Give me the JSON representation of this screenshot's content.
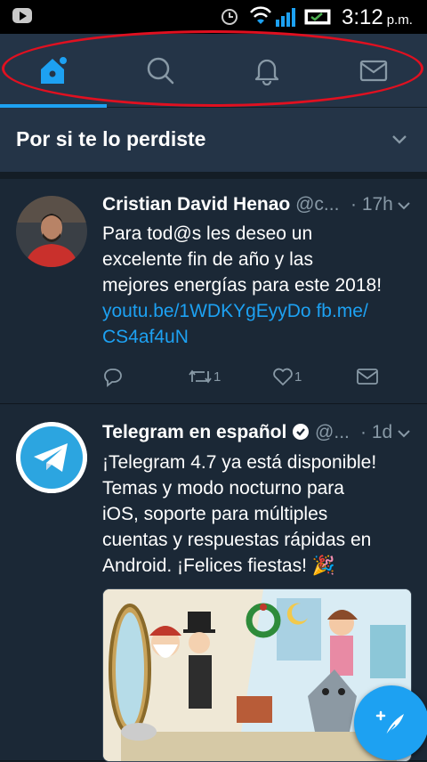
{
  "status_bar": {
    "time": "3:12",
    "ampm": "p.m."
  },
  "tabs": [
    {
      "name": "home",
      "icon": "home-icon",
      "active": true
    },
    {
      "name": "search",
      "icon": "search-icon"
    },
    {
      "name": "notifications",
      "icon": "bell-icon"
    },
    {
      "name": "messages",
      "icon": "mail-icon"
    }
  ],
  "section": {
    "title": "Por si te lo perdiste"
  },
  "tweets": [
    {
      "name": "Cristian David Henao",
      "handle": "@c...",
      "time": "· 17h",
      "text_lines": [
        "Para tod@s les deseo un",
        "excelente fin de año y las",
        "mejores energías para este 2018!"
      ],
      "link_line1": "youtu.be/1WDKYgEyyDo fb.me/",
      "link_line2": "CS4af4uN",
      "retweets": "1",
      "likes": "1"
    },
    {
      "name": "Telegram en español",
      "handle": "@...",
      "time": "· 1d",
      "verified": true,
      "text_lines": [
        "¡Telegram 4.7 ya está disponible!",
        "Temas y modo nocturno para",
        "iOS, soporte para múltiples",
        "cuentas y respuestas rápidas en",
        "Android. ¡Felices fiestas! 🎉"
      ]
    }
  ],
  "colors": {
    "accent": "#1da1f2",
    "background": "#141d26",
    "card": "#1b2836",
    "muted": "#8899a6"
  }
}
